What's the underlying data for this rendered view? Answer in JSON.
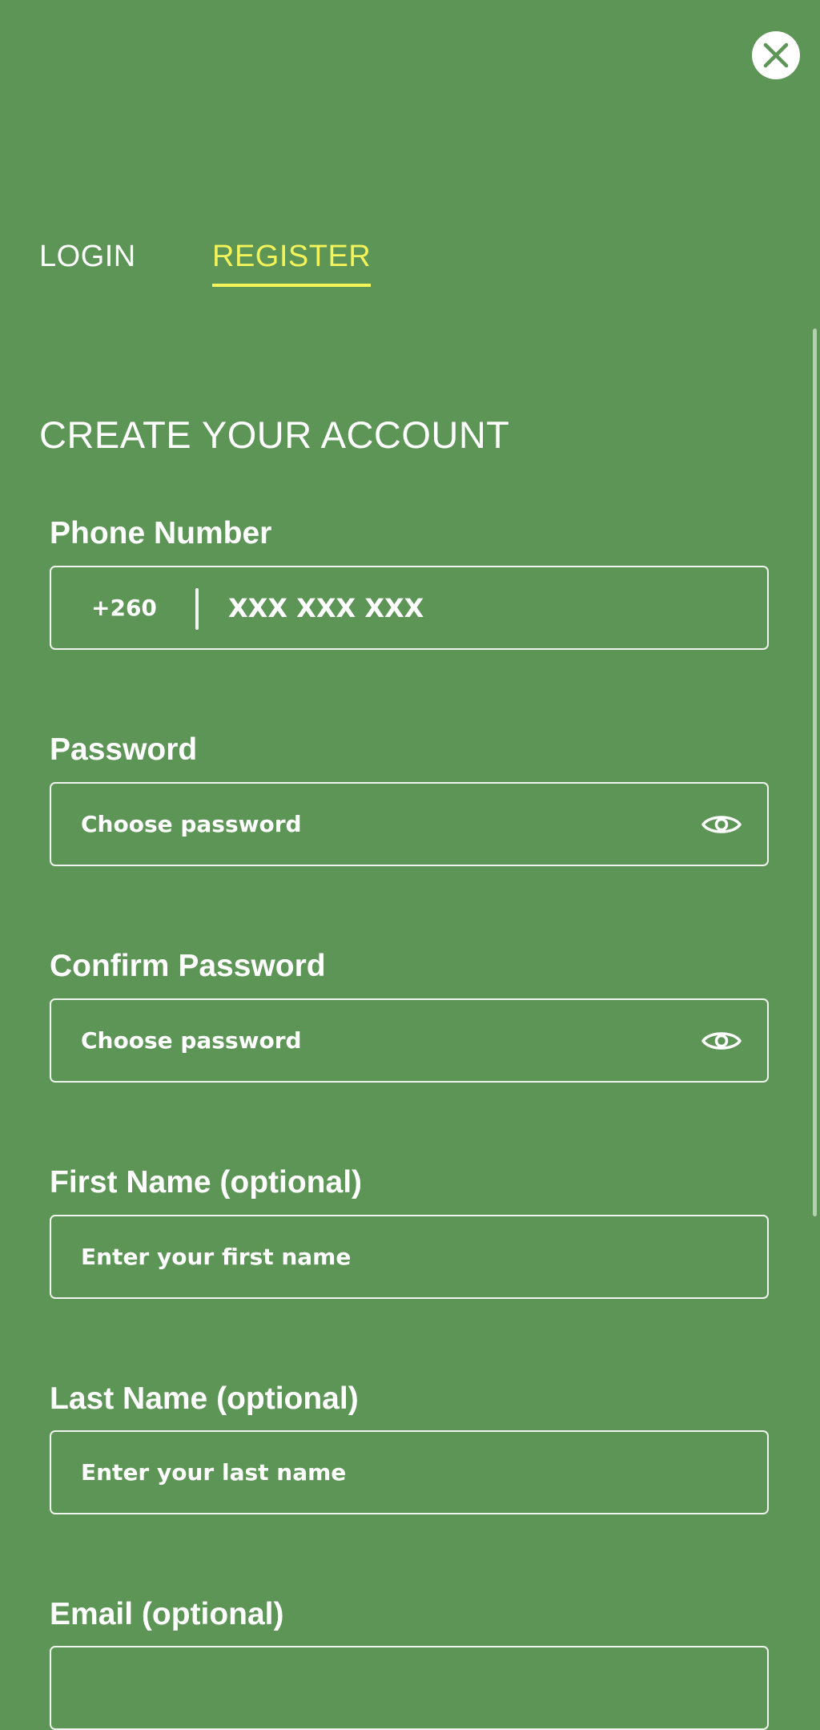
{
  "tabs": {
    "login": "LOGIN",
    "register": "REGISTER",
    "active": "register"
  },
  "title": "CREATE YOUR ACCOUNT",
  "phone": {
    "label": "Phone Number",
    "prefix": "+260",
    "placeholder": "XXX XXX XXX"
  },
  "password": {
    "label": "Password",
    "placeholder": "Choose password"
  },
  "confirm_password": {
    "label": "Confirm Password",
    "placeholder": "Choose password"
  },
  "first_name": {
    "label": "First Name (optional)",
    "placeholder": "Enter your first name"
  },
  "last_name": {
    "label": "Last Name (optional)",
    "placeholder": "Enter your last name"
  },
  "email": {
    "label": "Email (optional)",
    "placeholder": ""
  },
  "icons": {
    "close": "close-icon",
    "password_toggle": "eye-icon"
  },
  "colors": {
    "background": "#5c9556",
    "accent": "#f3f35a",
    "text": "#ffffff"
  }
}
